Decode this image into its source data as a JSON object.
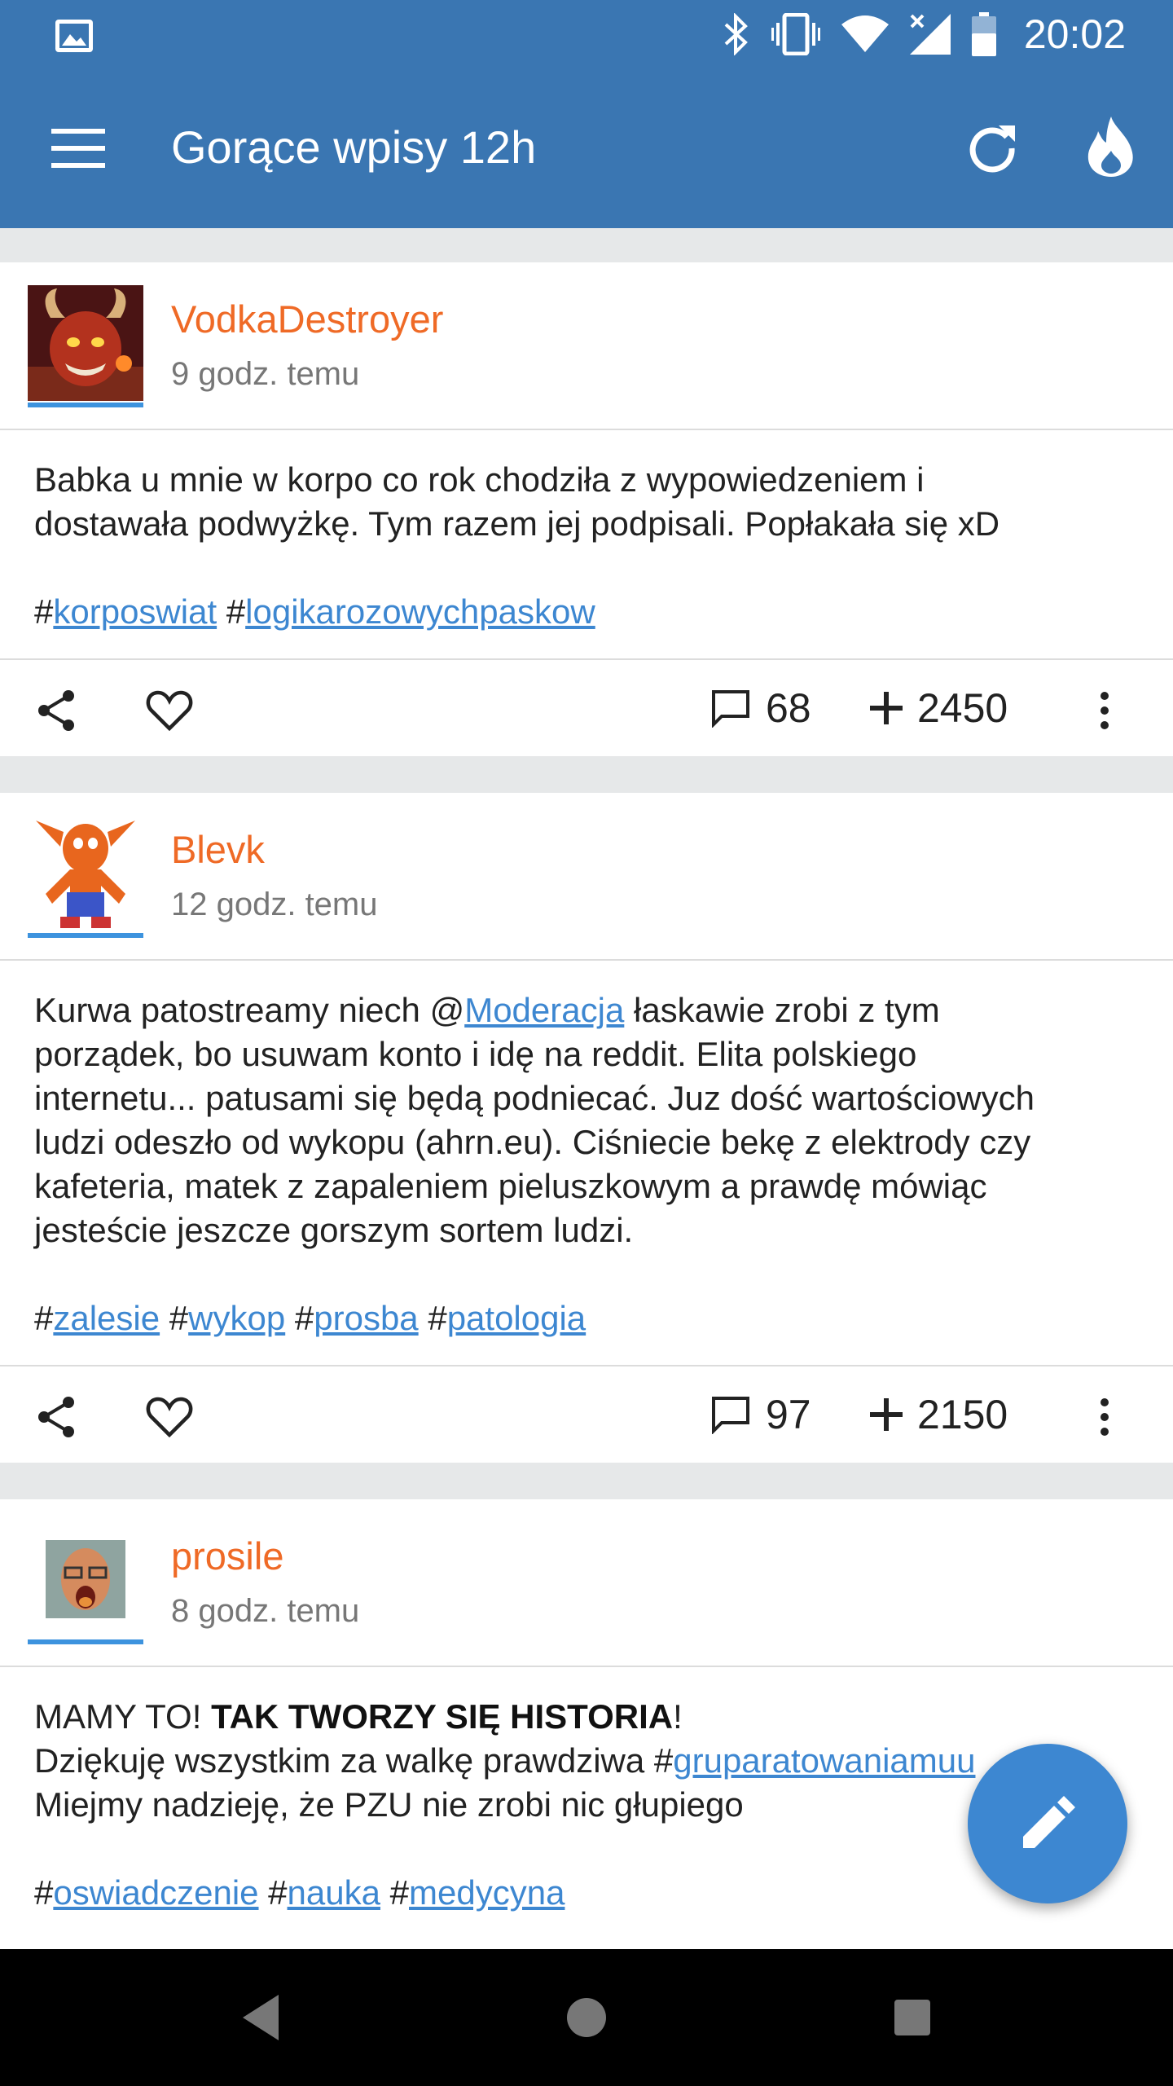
{
  "status_bar": {
    "time": "20:02",
    "icons": [
      "image-icon",
      "bluetooth-icon",
      "vibrate-icon",
      "wifi-icon",
      "cell-signal-icon",
      "battery-icon"
    ]
  },
  "app_bar": {
    "title": "Gorące wpisy 12h",
    "background_color": "#3a76b2",
    "icons": [
      "menu-icon",
      "refresh-icon",
      "flame-icon"
    ]
  },
  "posts": [
    {
      "author": "VodkaDestroyer",
      "time": "9 godz. temu",
      "body_line1": "Babka u mnie w korpo co rok chodziła z wypowiedzeniem i",
      "body_line2": "dostawała podwyżkę. Tym razem jej podpisali. Popłakała się xD",
      "tags": [
        "korposwiat",
        "logikarozowychpaskow"
      ],
      "comments": "68",
      "votes": "2450"
    },
    {
      "author": "Blevk",
      "time": "12 godz. temu",
      "body_pre_mention": "Kurwa patostreamy niech @",
      "mention": "Moderacja",
      "body_post_mention": " łaskawie zrobi z tym",
      "body_line2": "porządek, bo usuwam konto i idę na reddit. Elita polskiego",
      "body_line3": "internetu... patusami się będą podniecać. Juz dość wartościowych",
      "body_line4": "ludzi odeszło od wykopu (ahrn.eu). Ciśniecie bekę z elektrody czy",
      "body_line5": "kafeteria, matek z zapaleniem pieluszkowym a prawdę mówiąc",
      "body_line6": "jesteście jeszcze gorszym sortem ludzi.",
      "tags": [
        "zalesie",
        "wykop",
        "prosba",
        "patologia"
      ],
      "comments": "97",
      "votes": "2150"
    },
    {
      "author": "prosile",
      "time": "8 godz. temu",
      "body_line1_pre": "MAMY TO! ",
      "body_line1_bold": "TAK TWORZY SIĘ HISTORIA",
      "body_line1_post": "!",
      "body_line2_pre": "Dziękuję wszystkim za walkę prawdziwa #",
      "body_line2_tag": "gruparatowaniamuu",
      "body_line2_tag_visible": "gruparatowaniam",
      "body_line2_tag_tail": "mu",
      "body_line3": "Miejmy nadzieję, że PZU nie zrobi nic głupiego",
      "tags": [
        "oswiadczenie",
        "nauka",
        "medycyna"
      ]
    }
  ],
  "colors": {
    "author": "#ef6a26",
    "link": "#3d87d1",
    "fab": "#3d87d1"
  },
  "fab": {
    "icon": "pencil-icon"
  },
  "nav_bar": {
    "icons": [
      "back-icon",
      "home-icon",
      "recents-icon"
    ]
  }
}
